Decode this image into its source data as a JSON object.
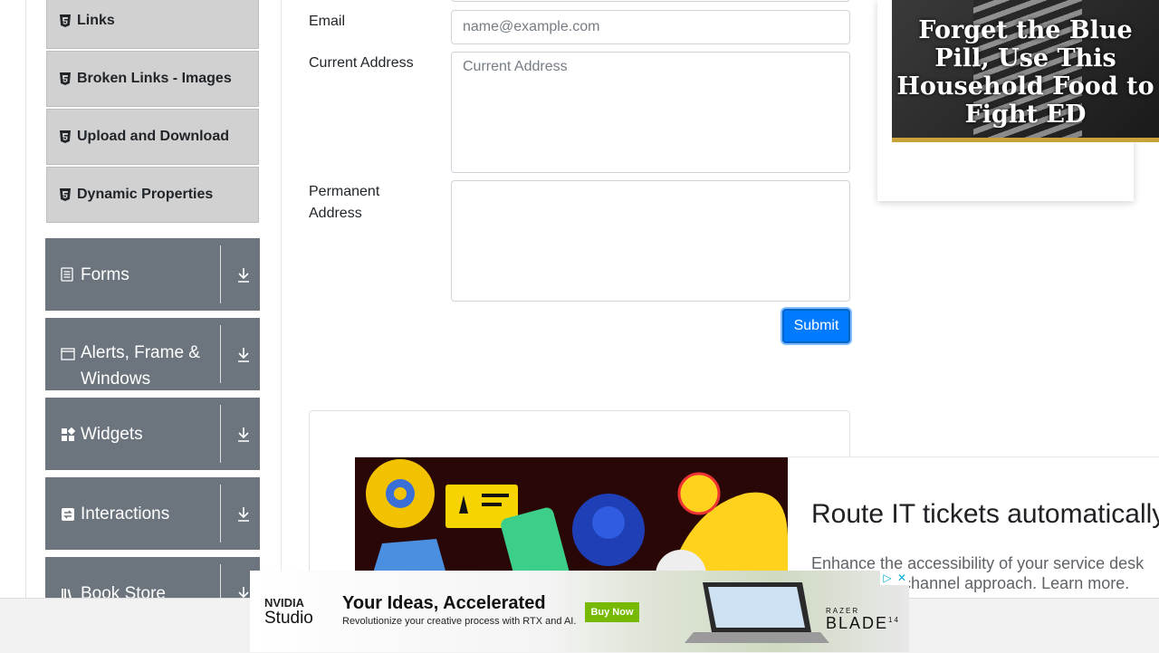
{
  "sidebar": {
    "elements_items": [
      {
        "label": "Links"
      },
      {
        "label": "Broken Links - Images"
      },
      {
        "label": "Upload and Download"
      },
      {
        "label": "Dynamic Properties"
      }
    ],
    "groups": [
      {
        "label": "Forms",
        "icon": "form-icon"
      },
      {
        "label": "Alerts, Frame & Windows",
        "icon": "window-icon"
      },
      {
        "label": "Widgets",
        "icon": "widgets-icon"
      },
      {
        "label": "Interactions",
        "icon": "interactions-icon"
      },
      {
        "label": "Book Store",
        "icon": "book-icon"
      }
    ]
  },
  "form": {
    "email_label": "Email",
    "email_placeholder": "name@example.com",
    "current_address_label": "Current Address",
    "current_address_placeholder": "Current Address",
    "permanent_address_label": "Permanent Address",
    "submit_label": "Submit"
  },
  "ads": {
    "right_ad_text": "Forget the Blue Pill, Use This Household Food to Fight ED",
    "mid_ad_headline": "Route IT tickets automatically",
    "mid_ad_desc": "Enhance the accessibility of your service desk with an omnichannel approach. Learn more.",
    "bottom_ad": {
      "brand_top": "NVIDIA",
      "brand_bottom": "Studio",
      "title": "Your Ideas, Accelerated",
      "subtitle": "Revolutionize your creative process with RTX and AI.",
      "cta": "Buy Now",
      "brand_right_top": "RAZER",
      "brand_right": "BLADE",
      "brand_right_suffix": "14"
    }
  },
  "colors": {
    "accent": "#007bff",
    "group_bg": "#6c757d",
    "subitem_bg": "#d1d1d1"
  }
}
